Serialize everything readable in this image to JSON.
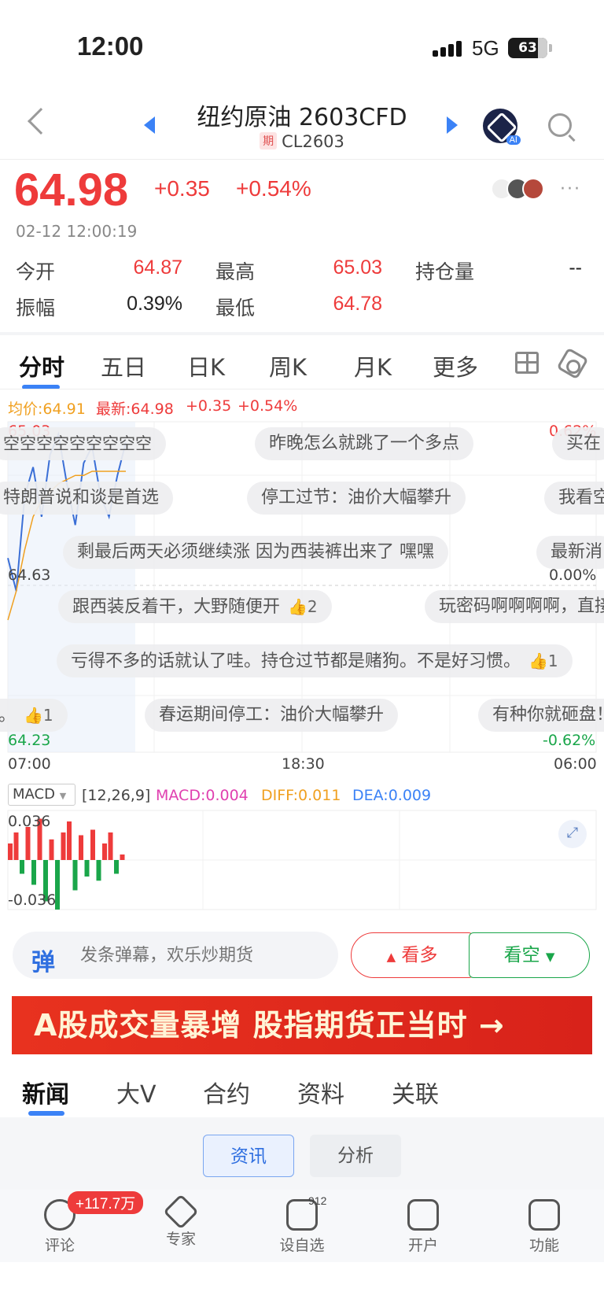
{
  "status_bar": {
    "time": "12:00",
    "network": "5G",
    "battery": "63"
  },
  "header": {
    "title": "纽约原油 2603CFD",
    "tag": "期",
    "code": "CL2603",
    "ai_badge": "AI"
  },
  "quote": {
    "price": "64.98",
    "change": "+0.35",
    "change_pct": "+0.54%",
    "timestamp": "02-12 12:00:19",
    "stats": {
      "open_label": "今开",
      "open": "64.87",
      "high_label": "最高",
      "high": "65.03",
      "oi_label": "持仓量",
      "oi": "--",
      "amp_label": "振幅",
      "amp": "0.39%",
      "low_label": "最低",
      "low": "64.78"
    }
  },
  "kline_tabs": [
    "分时",
    "五日",
    "日K",
    "周K",
    "月K",
    "更多"
  ],
  "chart": {
    "avg_label": "均价:64.91",
    "latest_label": "最新:64.98",
    "chg": "+0.35",
    "chg_pct": "+0.54%",
    "y_top": "65.03",
    "y_mid": "64.63",
    "y_bot": "64.23",
    "r_top": "0.62%",
    "r_mid": "0.00%",
    "r_bot": "-0.62%",
    "x_labels": [
      "07:00",
      "18:30",
      "06:00"
    ]
  },
  "chart_data": {
    "type": "line",
    "title": "",
    "xlabel": "",
    "ylabel": "",
    "ylim": [
      64.23,
      65.03
    ],
    "x_ticks": [
      "07:00",
      "18:30",
      "06:00"
    ],
    "series": [
      {
        "name": "",
        "values": [
          64.7,
          64.62,
          64.85,
          64.92,
          64.8,
          64.95,
          65.0,
          64.88,
          64.78,
          64.93,
          64.97,
          64.85,
          64.8,
          64.9,
          64.98
        ]
      },
      {
        "name": "均价",
        "values": [
          64.55,
          64.62,
          64.72,
          64.8,
          64.84,
          64.86,
          64.88,
          64.89,
          64.9,
          64.9,
          64.91,
          64.91,
          64.91,
          64.91,
          64.91
        ]
      }
    ],
    "macd": {
      "params": "[12,26,9]",
      "MACD": 0.004,
      "DIFF": 0.011,
      "DEA": 0.009,
      "ylim": [
        -0.036,
        0.036
      ],
      "bars": [
        0.012,
        0.02,
        -0.01,
        0.024,
        -0.018,
        0.03,
        -0.03,
        0.015,
        -0.036,
        0.02,
        0.028,
        -0.022,
        0.018,
        -0.012,
        0.022,
        -0.015,
        0.012,
        0.02,
        -0.01,
        0.004
      ]
    }
  },
  "barrages": [
    {
      "text": "空空空空空空空空空",
      "likes": ""
    },
    {
      "text": "昨晚怎么就跳了一个多点",
      "likes": ""
    },
    {
      "text": "买在",
      "likes": ""
    },
    {
      "text": "特朗普说和谈是首选",
      "likes": ""
    },
    {
      "text": "停工过节：油价大幅攀升",
      "likes": ""
    },
    {
      "text": "我看空",
      "likes": ""
    },
    {
      "text": "剩最后两天必须继续涨  因为西装裤出来了 嘿嘿",
      "likes": ""
    },
    {
      "text": "最新消",
      "likes": ""
    },
    {
      "text": "跟西装反着干，大野随便开",
      "likes": "2"
    },
    {
      "text": "玩密码啊啊啊啊，直接",
      "likes": ""
    },
    {
      "text": "亏得不多的话就认了哇。持仓过节都是赌狗。不是好习惯。",
      "likes": "1"
    },
    {
      "text": "。",
      "likes": "1"
    },
    {
      "text": "春运期间停工：油价大幅攀升",
      "likes": ""
    },
    {
      "text": "有种你就砸盘！",
      "likes": ""
    }
  ],
  "macd_bar": {
    "select": "MACD",
    "params": "[12,26,9]",
    "macd": "MACD:0.004",
    "diff": "DIFF:0.011",
    "dea": "DEA:0.009",
    "top": "0.036",
    "bot": "-0.036"
  },
  "input_row": {
    "placeholder": "发条弹幕，欢乐炒期货",
    "bull": "看多",
    "bear": "看空",
    "icon": "弹"
  },
  "banner": "A股成交量暴增 股指期货正当时 →",
  "news_tabs": [
    "新闻",
    "大V",
    "合约",
    "资料",
    "关联"
  ],
  "sub_tabs": [
    "资讯",
    "分析"
  ],
  "tabbar": {
    "items": [
      "评论",
      "专家",
      "设自选",
      "开户",
      "功能"
    ],
    "comment_badge": "+117.7万",
    "watch_count": "912"
  },
  "colors": {
    "up": "#ee3b3b",
    "down": "#1aa64a",
    "accent": "#3b82f6"
  }
}
